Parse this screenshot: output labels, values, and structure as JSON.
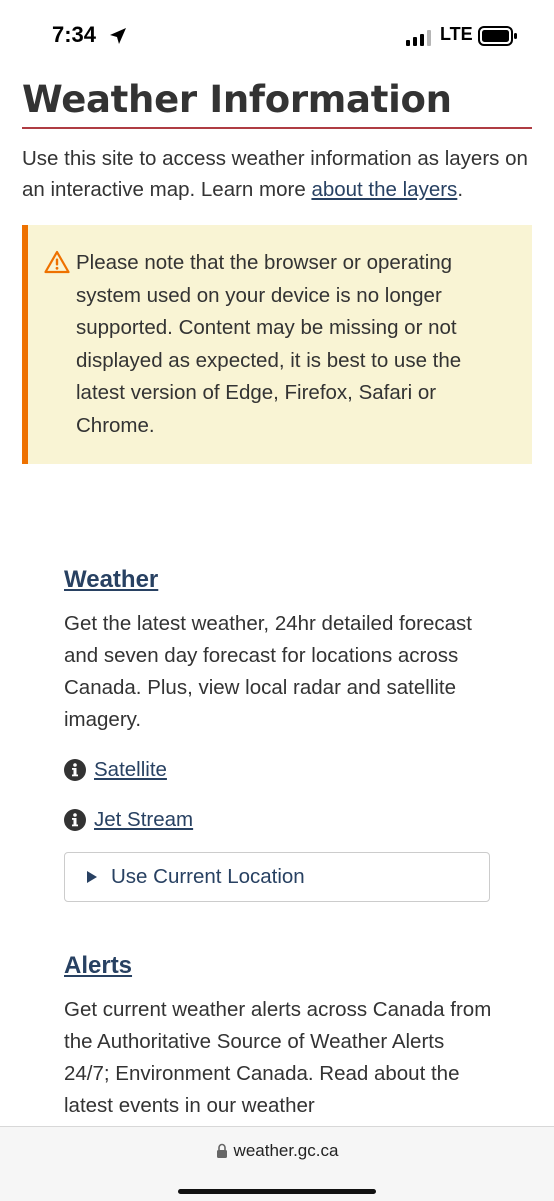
{
  "status_bar": {
    "time": "7:34",
    "network": "LTE"
  },
  "page": {
    "title": "Weather Information",
    "intro_text": "Use this site to access weather information as layers on an interactive map. Learn more ",
    "intro_link": "about the layers",
    "intro_end": "."
  },
  "notice": {
    "text": "Please note that the browser or operating system used on your device is no longer supported. Content may be missing or not displayed as expected, it is best to use the latest version of Edge, Firefox, Safari or Chrome.",
    "icon": "warning-icon"
  },
  "weather_section": {
    "heading": "Weather",
    "description": "Get the latest weather, 24hr detailed forecast and seven day forecast for locations across Canada. Plus, view local radar and satellite imagery.",
    "links": [
      "Satellite",
      "Jet Stream"
    ],
    "location_button": "Use Current Location"
  },
  "alerts_section": {
    "heading": "Alerts",
    "description": "Get current weather alerts across Canada from the Authoritative Source of Weather Alerts 24/7; Environment Canada. Read about the latest events in our weather"
  },
  "browser": {
    "url": "weather.gc.ca"
  },
  "colors": {
    "link": "#284162",
    "title_rule": "#af3c43",
    "notice_bg": "#f9f4d4",
    "notice_border": "#ee7100"
  }
}
